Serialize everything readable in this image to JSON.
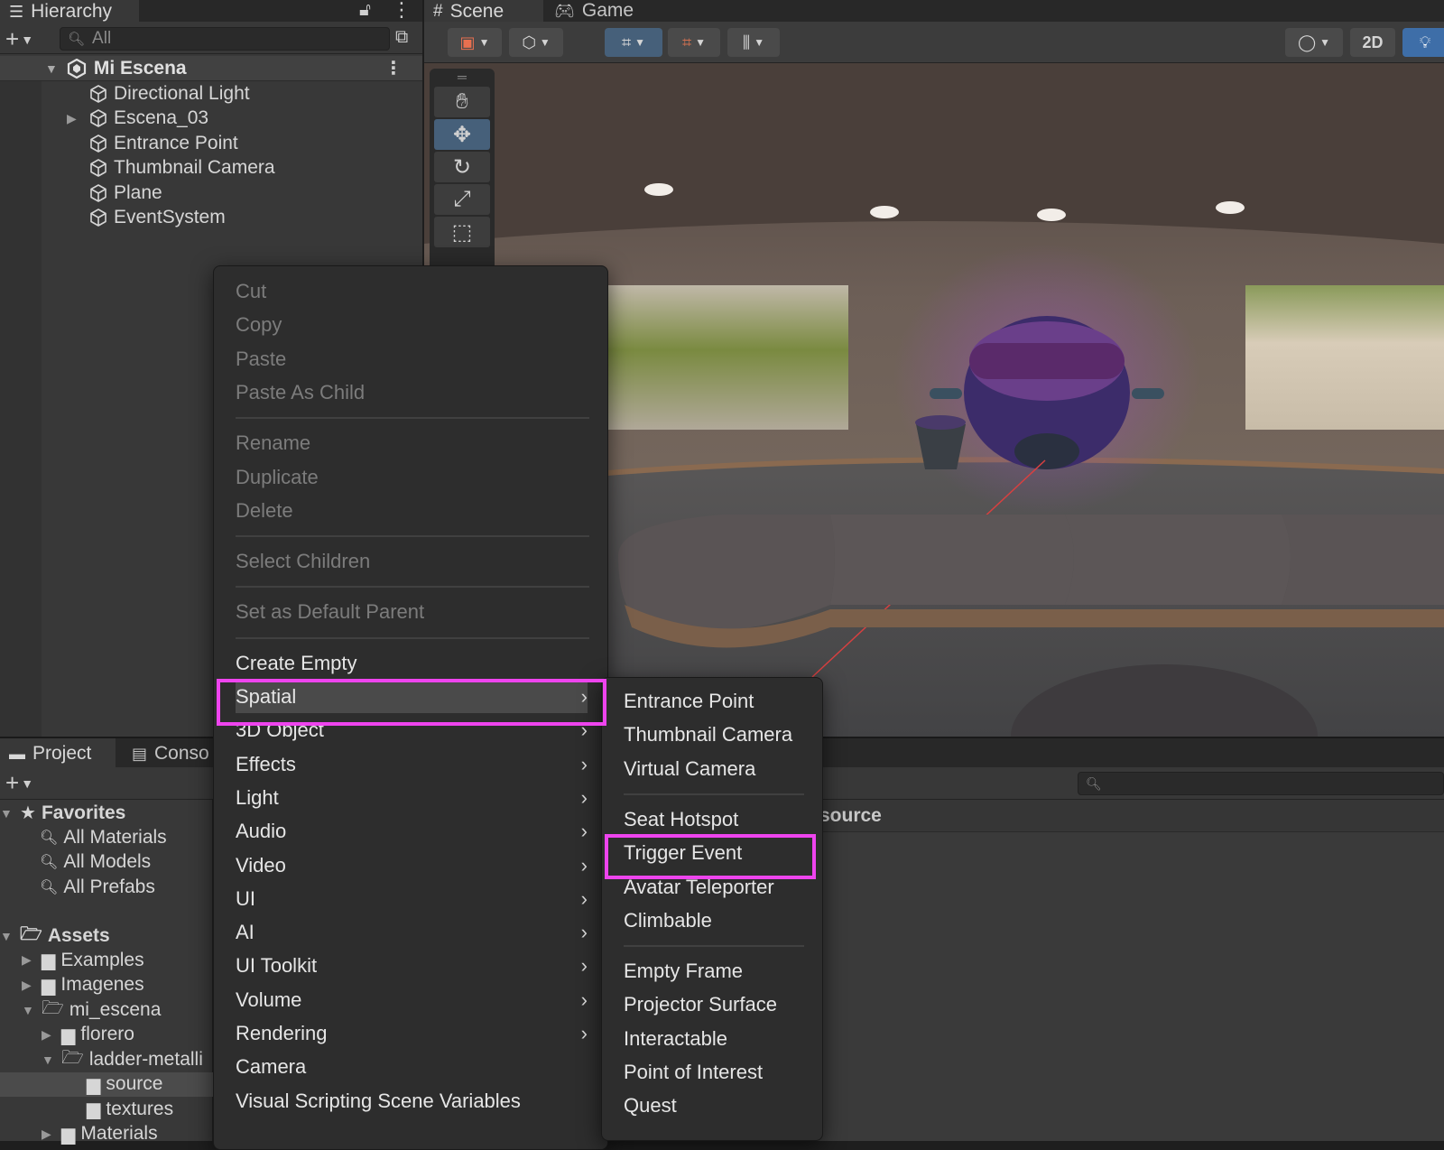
{
  "hierarchy": {
    "tab_label": "Hierarchy",
    "search_placeholder": "All",
    "scene_name": "Mi Escena",
    "items": [
      {
        "label": "Directional Light",
        "expandable": false
      },
      {
        "label": "Escena_03",
        "expandable": true
      },
      {
        "label": "Entrance Point",
        "expandable": false
      },
      {
        "label": "Thumbnail Camera",
        "expandable": false
      },
      {
        "label": "Plane",
        "expandable": false
      },
      {
        "label": "EventSystem",
        "expandable": false
      }
    ]
  },
  "scene": {
    "tabs": [
      {
        "label": "Scene",
        "icon": "grid-icon"
      },
      {
        "label": "Game",
        "icon": "gamepad-icon"
      }
    ],
    "toolbar": {
      "mode_2d_label": "2D"
    }
  },
  "project": {
    "tabs": [
      {
        "label": "Project",
        "icon": "folder-icon"
      },
      {
        "label": "Conso",
        "icon": "console-icon"
      }
    ],
    "breadcrumb_partial": "source",
    "favorites_label": "Favorites",
    "favorites": [
      "All Materials",
      "All Models",
      "All Prefabs"
    ],
    "assets_label": "Assets",
    "assets": [
      {
        "label": "Examples",
        "depth": 1,
        "expanded": false
      },
      {
        "label": "Imagenes",
        "depth": 1,
        "expanded": false
      },
      {
        "label": "mi_escena",
        "depth": 1,
        "expanded": true
      },
      {
        "label": "florero",
        "depth": 2,
        "expanded": false
      },
      {
        "label": "ladder-metalli",
        "depth": 2,
        "expanded": true
      },
      {
        "label": "source",
        "depth": 3,
        "expanded": false,
        "selected": true
      },
      {
        "label": "textures",
        "depth": 3,
        "expanded": false
      },
      {
        "label": "Materials",
        "depth": 2,
        "expanded": false
      }
    ]
  },
  "context_menu": {
    "clipboard": [
      "Cut",
      "Copy",
      "Paste",
      "Paste As Child"
    ],
    "editing": [
      "Rename",
      "Duplicate",
      "Delete"
    ],
    "select_children": "Select Children",
    "set_default_parent": "Set as Default Parent",
    "create_empty": "Create Empty",
    "submenus": [
      "Spatial",
      "3D Object",
      "Effects",
      "Light",
      "Audio",
      "Video",
      "UI",
      "AI",
      "UI Toolkit",
      "Volume",
      "Rendering"
    ],
    "tail": [
      "Camera",
      "Visual Scripting Scene Variables"
    ]
  },
  "spatial_submenu": {
    "group1": [
      "Entrance Point",
      "Thumbnail Camera",
      "Virtual Camera"
    ],
    "group2": [
      "Seat Hotspot",
      "Trigger Event",
      "Avatar Teleporter",
      "Climbable"
    ],
    "group3": [
      "Empty Frame",
      "Projector Surface",
      "Interactable",
      "Point of Interest",
      "Quest"
    ]
  },
  "colors": {
    "highlight": "#ee44ee",
    "selection_blue": "#46607a",
    "panel_bg": "#383838",
    "menu_bg": "#2d2d2d"
  }
}
